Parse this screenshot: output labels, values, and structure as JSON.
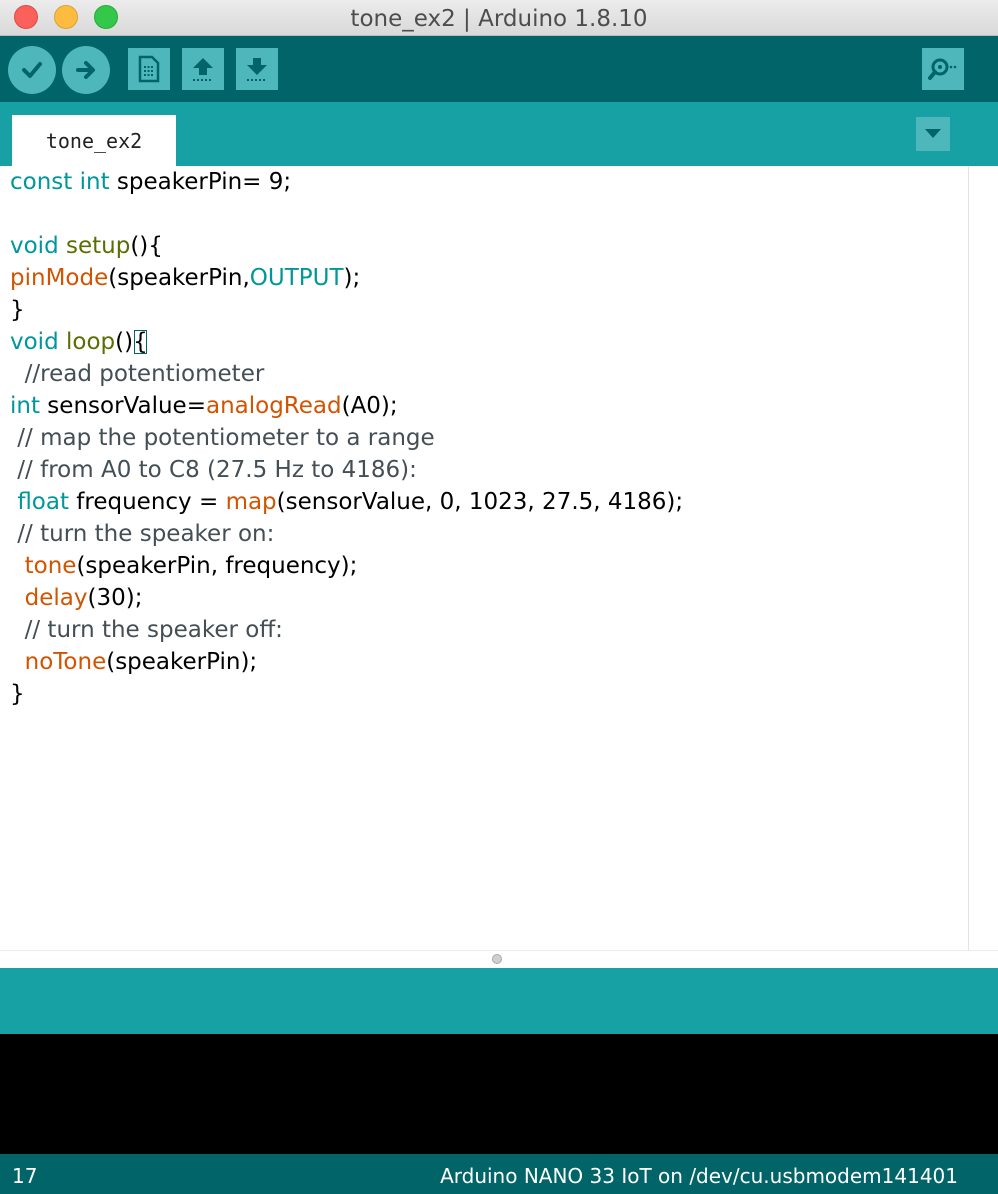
{
  "window": {
    "title": "tone_ex2 | Arduino 1.8.10"
  },
  "toolbar": {
    "buttons": [
      {
        "name": "verify",
        "icon": "checkmark-icon"
      },
      {
        "name": "upload",
        "icon": "arrow-right-icon"
      },
      {
        "name": "new",
        "icon": "document-icon"
      },
      {
        "name": "open",
        "icon": "arrow-up-icon"
      },
      {
        "name": "save",
        "icon": "arrow-down-icon"
      },
      {
        "name": "serial-monitor",
        "icon": "magnifier-icon"
      }
    ]
  },
  "tabs": {
    "active": "tone_ex2"
  },
  "code": {
    "l1": {
      "a": "const",
      "b": " ",
      "c": "int",
      "d": " speakerPin= 9;"
    },
    "l3": {
      "a": "void",
      "b": " ",
      "c": "setup",
      "d": "(){"
    },
    "l4": {
      "a": "pinMode",
      "b": "(speakerPin,",
      "c": "OUTPUT",
      "d": ");"
    },
    "l5": {
      "a": "}"
    },
    "l6": {
      "a": "void",
      "b": " ",
      "c": "loop",
      "d": "()",
      "e": "{"
    },
    "l7": {
      "a": "  //read potentiometer"
    },
    "l8": {
      "a": "int",
      "b": " sensorValue=",
      "c": "analogRead",
      "d": "(A0);"
    },
    "l9": {
      "a": " // map the potentiometer to a range"
    },
    "l10": {
      "a": " // from A0 to C8 (27.5 Hz to 4186):"
    },
    "l11": {
      "a": " ",
      "b": "float",
      "c": " frequency = ",
      "d": "map",
      "e": "(sensorValue, 0, 1023, 27.5, 4186);"
    },
    "l12": {
      "a": " // turn the speaker on:"
    },
    "l13": {
      "a": "  ",
      "b": "tone",
      "c": "(speakerPin, frequency);"
    },
    "l14": {
      "a": "  ",
      "b": "delay",
      "c": "(30);"
    },
    "l15": {
      "a": "  // turn the speaker off:"
    },
    "l16": {
      "a": "  ",
      "b": "noTone",
      "c": "(speakerPin);"
    },
    "l17": {
      "a": "}"
    }
  },
  "status": {
    "line_number": "17",
    "board": "Arduino NANO 33 IoT on /dev/cu.usbmodem141401"
  },
  "colors": {
    "toolbar": "#006468",
    "tabstrip": "#17a1a5",
    "button": "#4db7bb",
    "keyword": "#00979c",
    "function_green": "#5e6d03",
    "function_orange": "#d35400",
    "comment": "#434f54"
  }
}
